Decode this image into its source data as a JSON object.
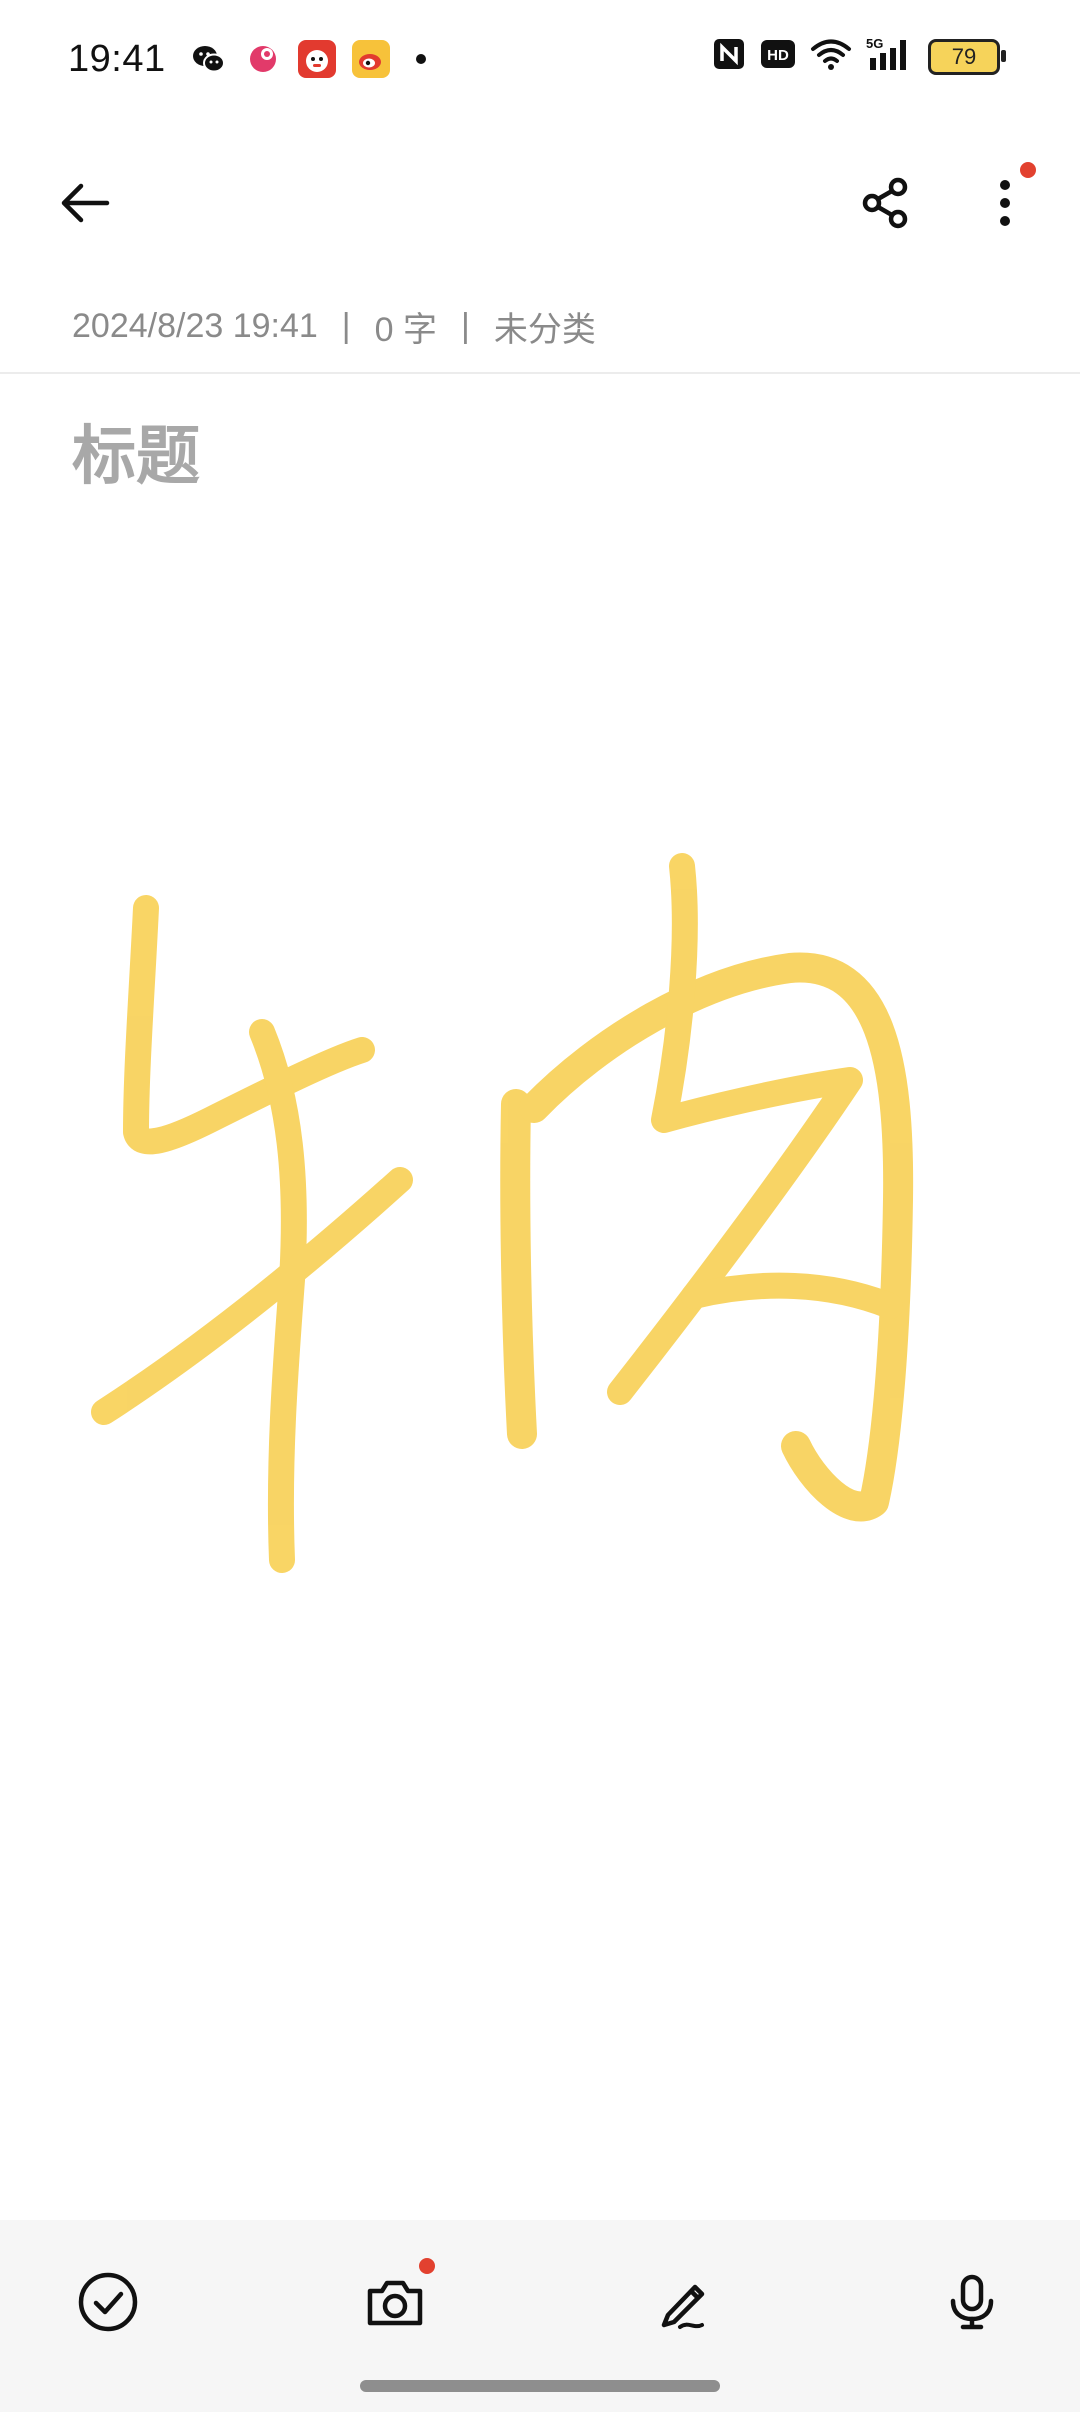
{
  "status_bar": {
    "time": "19:41",
    "battery_level": "79",
    "network": "5G",
    "hd_label": "HD",
    "nfc_label": "N",
    "notifications": [
      "wechat-icon",
      "chat-bubble-app-icon",
      "red-face-app-icon",
      "weibo-icon"
    ]
  },
  "top_bar": {
    "back_icon": "arrow-left-icon",
    "share_icon": "share-icon",
    "more_icon": "more-vertical-icon",
    "more_badge": true
  },
  "meta": {
    "datetime": "2024/8/23 19:41",
    "word_count": "0 字",
    "category": "未分类",
    "separator": "|"
  },
  "note": {
    "title_placeholder": "标题",
    "drawing_color": "#F7C93A"
  },
  "bottom_toolbar": {
    "items": [
      {
        "name": "checklist-button",
        "icon": "check-circle-icon"
      },
      {
        "name": "camera-button",
        "icon": "camera-icon",
        "badge": true
      },
      {
        "name": "handwriting-button",
        "icon": "pen-icon"
      },
      {
        "name": "voice-button",
        "icon": "microphone-icon"
      }
    ]
  },
  "colors": {
    "accent_red": "#E2412F",
    "meta_text": "#8A8A8A",
    "toolbar_bg": "#F6F6F6"
  }
}
